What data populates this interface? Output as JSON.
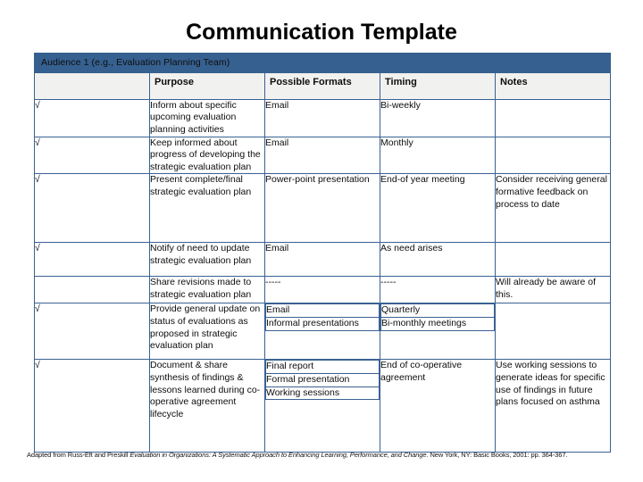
{
  "page": {
    "title": "Communication Template"
  },
  "table": {
    "audience_band": "Audience 1 (e.g., Evaluation Planning Team)",
    "columns": {
      "check": "",
      "purpose": "Purpose",
      "formats": "Possible Formats",
      "timing": "Timing",
      "notes": "Notes"
    },
    "check_mark": "√",
    "rows": [
      {
        "check": "√",
        "purpose": "Inform about specific upcoming evaluation planning activities",
        "formats": [
          "Email"
        ],
        "timing": [
          "Bi-weekly"
        ],
        "notes": ""
      },
      {
        "check": "√",
        "purpose": "Keep informed about progress of developing the strategic evaluation plan",
        "formats": [
          "Email"
        ],
        "timing": [
          "Monthly"
        ],
        "notes": ""
      },
      {
        "check": "√",
        "purpose": "Present complete/final strategic evaluation plan",
        "formats": [
          "Power-point presentation"
        ],
        "timing": [
          "End-of year meeting"
        ],
        "notes": "Consider receiving general formative feedback on process to date"
      },
      {
        "check": "√",
        "purpose": "Notify of need to update strategic evaluation plan",
        "formats": [
          "Email"
        ],
        "timing": [
          "As need arises"
        ],
        "notes": ""
      },
      {
        "check": "",
        "purpose": "Share revisions made to strategic evaluation plan",
        "formats": [
          "-----"
        ],
        "timing": [
          "-----"
        ],
        "notes": "Will already be aware of this."
      },
      {
        "check": "√",
        "purpose": "Provide general update on status of evaluations as proposed in strategic evaluation plan",
        "formats": [
          "Email",
          "Informal presentations"
        ],
        "timing": [
          "Quarterly",
          "Bi-monthly meetings"
        ],
        "notes": ""
      },
      {
        "check": "√",
        "purpose": "Document & share synthesis of findings & lessons learned during co-operative agreement lifecycle",
        "formats": [
          "Final report",
          "Formal presentation",
          "Working sessions"
        ],
        "timing": [
          "End of co-operative agreement"
        ],
        "notes": "Use working sessions to generate ideas for specific use of findings in future plans focused on asthma"
      }
    ]
  },
  "footnote": {
    "prefix": "Adapted from Russ-Eft and Preskill ",
    "italic": "Evaluation in Organizations: A Systematic Approach to Enhancing Learning, Performance, and Change",
    "suffix": ". New York, NY: Basic Books, 2001: pp. 364-367."
  },
  "colors": {
    "band": "#36608F",
    "border": "#3A6292",
    "header_bg": "#F1F1EF"
  }
}
